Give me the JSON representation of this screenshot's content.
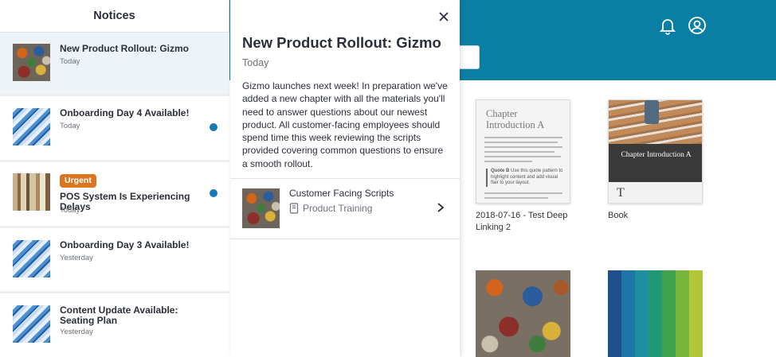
{
  "background": {
    "cards": [
      {
        "title": "2018-07-16 - Test Deep Linking 2",
        "thumb_heading": "Chapter Introduction A",
        "quote_label": "Quote B",
        "quote_text": "Use this quote pattern to highlight content and add visual flair to your layout."
      },
      {
        "title": "Book",
        "thumb_heading": "Chapter Introduction A"
      }
    ]
  },
  "notices": {
    "title": "Notices",
    "items": [
      {
        "title": "New Product Rollout: Gizmo",
        "date": "Today",
        "unread": false,
        "urgent": false,
        "selected": true
      },
      {
        "title": "Onboarding Day 4 Available!",
        "date": "Today",
        "unread": true,
        "urgent": false
      },
      {
        "title": "POS System Is Experiencing Delays",
        "date": "Today",
        "unread": true,
        "urgent": true,
        "badge": "Urgent"
      },
      {
        "title": "Onboarding Day 3 Available!",
        "date": "Yesterday",
        "unread": false,
        "urgent": false
      },
      {
        "title": "Content Update Available: Seating Plan",
        "date": "Yesterday",
        "unread": false,
        "urgent": false
      }
    ]
  },
  "detail": {
    "title": "New Product Rollout: Gizmo",
    "date": "Today",
    "body": "Gizmo launches next week! In preparation we've added a new chapter with all the materials you'll need to answer questions about our newest product. All customer-facing employees should spend time this week reviewing the scripts provided covering common questions to ensure a smooth rollout.",
    "attachment": {
      "title": "Customer Facing Scripts",
      "category": "Product Training"
    }
  },
  "colors": {
    "header": "#0b7fa3",
    "unread_dot": "#1479b8",
    "urgent": "#d9761f"
  }
}
